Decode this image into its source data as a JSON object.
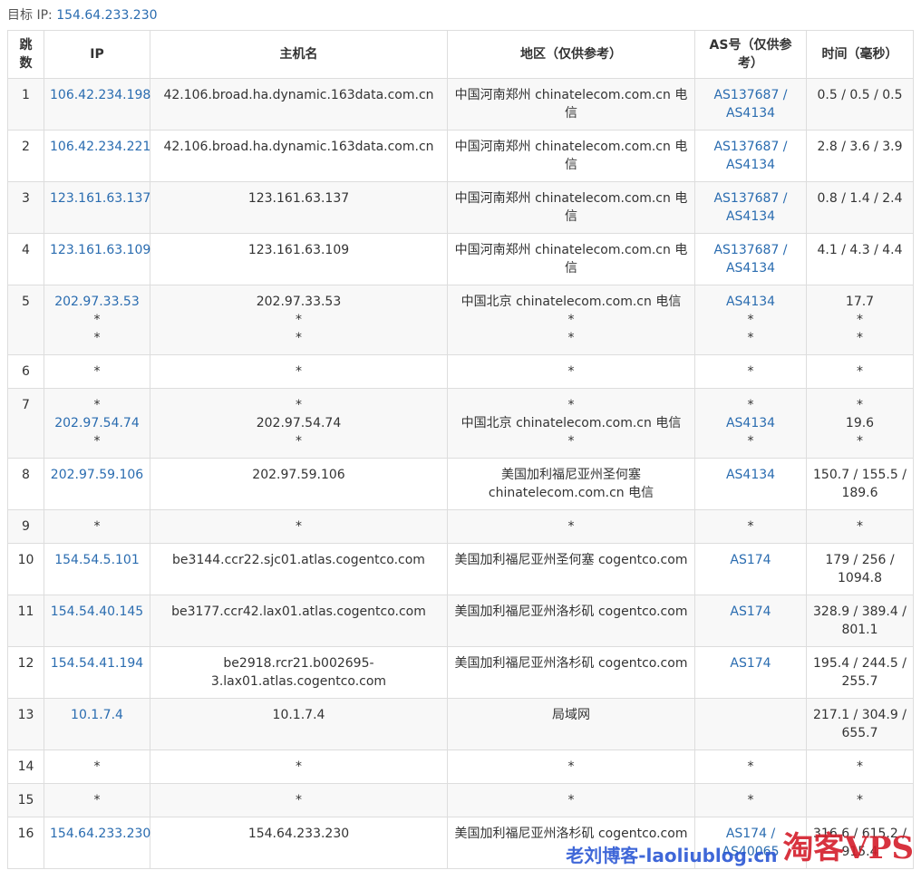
{
  "target": {
    "label": "目标 IP:",
    "ip": "154.64.233.230"
  },
  "table": {
    "headers": {
      "hop": [
        "跳",
        "数"
      ],
      "ip": "IP",
      "host": "主机名",
      "region": "地区（仅供参考）",
      "as": [
        "AS号（仅供参",
        "考）"
      ],
      "time": "时间（毫秒）"
    },
    "rows": [
      {
        "hop": "1",
        "ip": [
          "106.42.234.198"
        ],
        "host": [
          "42.106.broad.ha.dynamic.163data.com.cn"
        ],
        "region": [
          "中国河南郑州 chinatelecom.com.cn 电",
          "信"
        ],
        "as": [
          "AS137687 /",
          "AS4134"
        ],
        "time": [
          "0.5 / 0.5 / 0.5"
        ]
      },
      {
        "hop": "2",
        "ip": [
          "106.42.234.221"
        ],
        "host": [
          "42.106.broad.ha.dynamic.163data.com.cn"
        ],
        "region": [
          "中国河南郑州 chinatelecom.com.cn 电",
          "信"
        ],
        "as": [
          "AS137687 /",
          "AS4134"
        ],
        "time": [
          "2.8 / 3.6 / 3.9"
        ]
      },
      {
        "hop": "3",
        "ip": [
          "123.161.63.137"
        ],
        "host": [
          "123.161.63.137"
        ],
        "region": [
          "中国河南郑州 chinatelecom.com.cn 电",
          "信"
        ],
        "as": [
          "AS137687 /",
          "AS4134"
        ],
        "time": [
          "0.8 / 1.4 / 2.4"
        ]
      },
      {
        "hop": "4",
        "ip": [
          "123.161.63.109"
        ],
        "host": [
          "123.161.63.109"
        ],
        "region": [
          "中国河南郑州 chinatelecom.com.cn 电",
          "信"
        ],
        "as": [
          "AS137687 /",
          "AS4134"
        ],
        "time": [
          "4.1 / 4.3 / 4.4"
        ]
      },
      {
        "hop": "5",
        "ip": [
          "202.97.33.53",
          "*",
          "*"
        ],
        "host": [
          "202.97.33.53",
          "*",
          "*"
        ],
        "region": [
          "中国北京 chinatelecom.com.cn 电信",
          "*",
          "*"
        ],
        "as": [
          "AS4134",
          "*",
          "*"
        ],
        "time": [
          "17.7",
          "*",
          "*"
        ]
      },
      {
        "hop": "6",
        "ip": [
          "*"
        ],
        "host": [
          "*"
        ],
        "region": [
          "*"
        ],
        "as": [
          "*"
        ],
        "time": [
          "*"
        ]
      },
      {
        "hop": "7",
        "ip": [
          "*",
          "202.97.54.74",
          "*"
        ],
        "host": [
          "*",
          "202.97.54.74",
          "*"
        ],
        "region": [
          "*",
          "中国北京 chinatelecom.com.cn 电信",
          "*"
        ],
        "as": [
          "*",
          "AS4134",
          "*"
        ],
        "time": [
          "*",
          "19.6",
          "*"
        ]
      },
      {
        "hop": "8",
        "ip": [
          "202.97.59.106"
        ],
        "host": [
          "202.97.59.106"
        ],
        "region": [
          "美国加利福尼亚州圣何塞",
          "chinatelecom.com.cn 电信"
        ],
        "as": [
          "AS4134"
        ],
        "time": [
          "150.7 / 155.5 /",
          "189.6"
        ]
      },
      {
        "hop": "9",
        "ip": [
          "*"
        ],
        "host": [
          "*"
        ],
        "region": [
          "*"
        ],
        "as": [
          "*"
        ],
        "time": [
          "*"
        ]
      },
      {
        "hop": "10",
        "ip": [
          "154.54.5.101"
        ],
        "host": [
          "be3144.ccr22.sjc01.atlas.cogentco.com"
        ],
        "region": [
          "美国加利福尼亚州圣何塞 cogentco.com"
        ],
        "as": [
          "AS174"
        ],
        "time": [
          "179 / 256 /",
          "1094.8"
        ]
      },
      {
        "hop": "11",
        "ip": [
          "154.54.40.145"
        ],
        "host": [
          "be3177.ccr42.lax01.atlas.cogentco.com"
        ],
        "region": [
          "美国加利福尼亚州洛杉矶 cogentco.com"
        ],
        "as": [
          "AS174"
        ],
        "time": [
          "328.9 / 389.4 /",
          "801.1"
        ]
      },
      {
        "hop": "12",
        "ip": [
          "154.54.41.194"
        ],
        "host": [
          "be2918.rcr21.b002695-",
          "3.lax01.atlas.cogentco.com"
        ],
        "region": [
          "美国加利福尼亚州洛杉矶 cogentco.com"
        ],
        "as": [
          "AS174"
        ],
        "time": [
          "195.4 / 244.5 /",
          "255.7"
        ]
      },
      {
        "hop": "13",
        "ip": [
          "10.1.7.4"
        ],
        "host": [
          "10.1.7.4"
        ],
        "region": [
          "局域网"
        ],
        "as": [],
        "time": [
          "217.1 / 304.9 /",
          "655.7"
        ]
      },
      {
        "hop": "14",
        "ip": [
          "*"
        ],
        "host": [
          "*"
        ],
        "region": [
          "*"
        ],
        "as": [
          "*"
        ],
        "time": [
          "*"
        ]
      },
      {
        "hop": "15",
        "ip": [
          "*"
        ],
        "host": [
          "*"
        ],
        "region": [
          "*"
        ],
        "as": [
          "*"
        ],
        "time": [
          "*"
        ]
      },
      {
        "hop": "16",
        "ip": [
          "154.64.233.230"
        ],
        "host": [
          "154.64.233.230"
        ],
        "region": [
          "美国加利福尼亚州洛杉矶 cogentco.com"
        ],
        "as": [
          "AS174 /",
          "AS40065"
        ],
        "time": [
          "316.6 / 615.2 /",
          "915.4"
        ]
      }
    ]
  },
  "watermark": {
    "blog": "老刘博客-laoliublog.cn",
    "brand": "淘客VPS"
  }
}
